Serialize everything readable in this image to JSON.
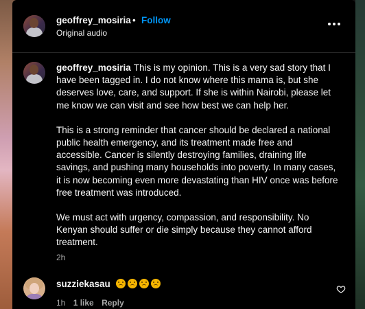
{
  "header": {
    "username": "geoffrey_mosiria",
    "separator": "•",
    "follow_label": "Follow",
    "audio_label": "Original audio",
    "more_icon": "more-options-icon"
  },
  "caption": {
    "username": "geoffrey_mosiria",
    "paragraph_1": "This is my opinion. This is a very sad story that I have been tagged in. I do not know where this mama is, but she deserves love, care, and support. If she is within Nairobi, please let me know we can visit and see how best we can help her.",
    "paragraph_2": "This is a strong reminder that cancer should be declared a national public health emergency, and its treatment made free and accessible. Cancer is silently destroying families, draining life savings, and pushing many households into poverty. In many cases, it is now becoming even more devastating than HIV once was before free treatment was introduced.",
    "paragraph_3": "We must act with urgency, compassion, and responsibility. No Kenyan should suffer or die simply because they cannot afford treatment.",
    "time": "2h"
  },
  "comment": {
    "username": "suzziekasau",
    "emoji_name": "sad-face-emoji",
    "emoji_count": 4,
    "time": "1h",
    "likes": "1 like",
    "reply_label": "Reply",
    "like_icon": "heart-icon"
  },
  "colors": {
    "background": "#000000",
    "text": "#f5f5f5",
    "secondary_text": "#a8a8a8",
    "follow_blue": "#0095f6"
  }
}
